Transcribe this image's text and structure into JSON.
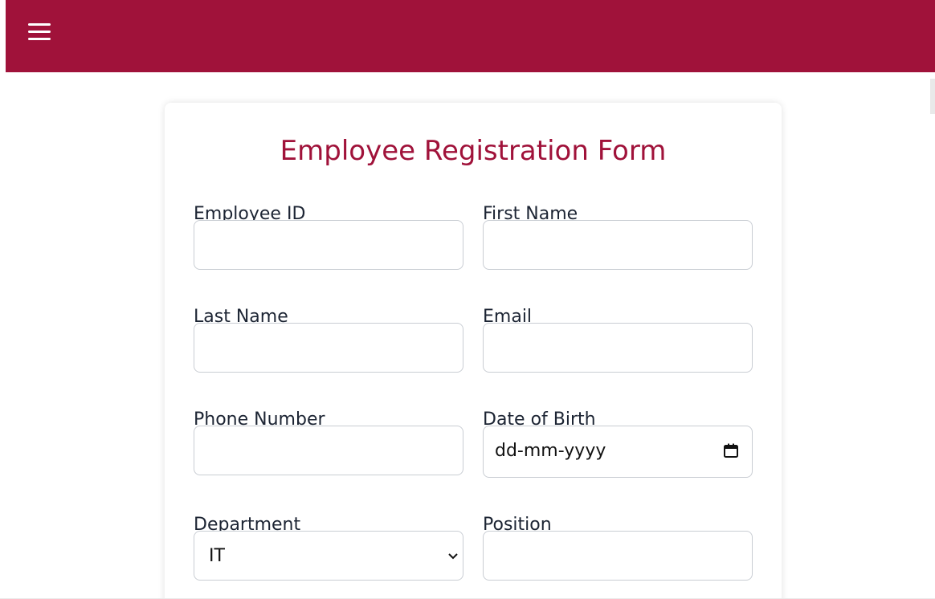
{
  "header": {
    "menu_icon": "hamburger-menu-icon",
    "background_color": "#a0123a"
  },
  "form": {
    "title": "Employee Registration Form",
    "title_color": "#a0123a",
    "fields": {
      "employee_id": {
        "label": "Employee ID",
        "value": ""
      },
      "first_name": {
        "label": "First Name",
        "value": ""
      },
      "last_name": {
        "label": "Last Name",
        "value": ""
      },
      "email": {
        "label": "Email",
        "value": ""
      },
      "phone_number": {
        "label": "Phone Number",
        "value": ""
      },
      "date_of_birth": {
        "label": "Date of Birth",
        "placeholder": "dd-mm-yyyy",
        "icon": "calendar-icon"
      },
      "department": {
        "label": "Department",
        "selected": "IT",
        "icon": "chevron-down-icon"
      },
      "position": {
        "label": "Position",
        "value": ""
      }
    }
  }
}
